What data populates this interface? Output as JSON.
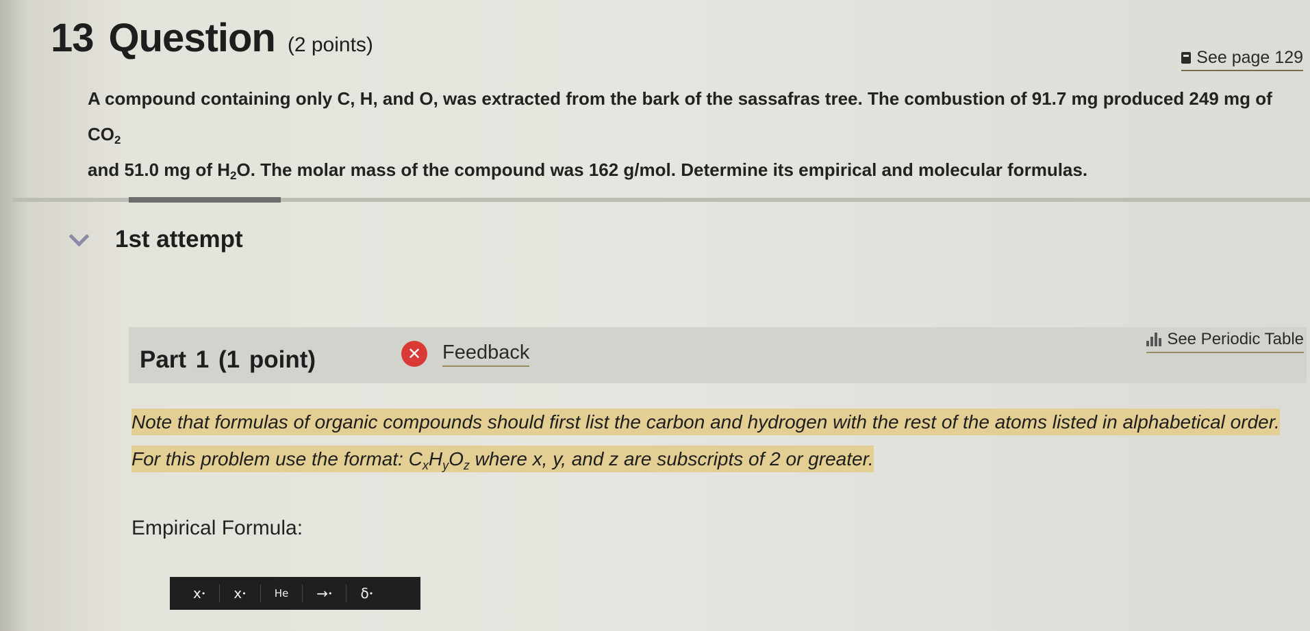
{
  "question": {
    "number": "13",
    "word": "Question",
    "points": "(2 points)"
  },
  "see_page": "See page 129",
  "question_text": {
    "part1": "A compound containing only C, H, and O, was extracted from the bark of the sassafras tree. The combustion of 91.7  mg produced 249  mg of CO",
    "co2_sub": "2",
    "part2": "and 51.0  mg of H",
    "h2o_sub": "2",
    "part3": "O. The molar mass of the compound was 162 g/mol. Determine its empirical and molecular formulas."
  },
  "attempt": {
    "label": "1st attempt"
  },
  "part": {
    "title": "Part 1   (1 point)",
    "feedback": "Feedback",
    "periodic_table": "See Periodic Table"
  },
  "note": {
    "text1": "Note that formulas of organic compounds should first list the carbon and hydrogen with the rest of the atoms listed in alphabetical order. For this problem use the format: C",
    "x": "x",
    "h": "H",
    "y": "y",
    "o": "O",
    "z": "z",
    "text2": " where x, y, and z are subscripts of 2 or greater."
  },
  "empirical_label": "Empirical Formula:",
  "toolbar": {
    "superscript": "x",
    "subscript": "x",
    "element": "He",
    "arrow": "→",
    "delta": "δ"
  }
}
